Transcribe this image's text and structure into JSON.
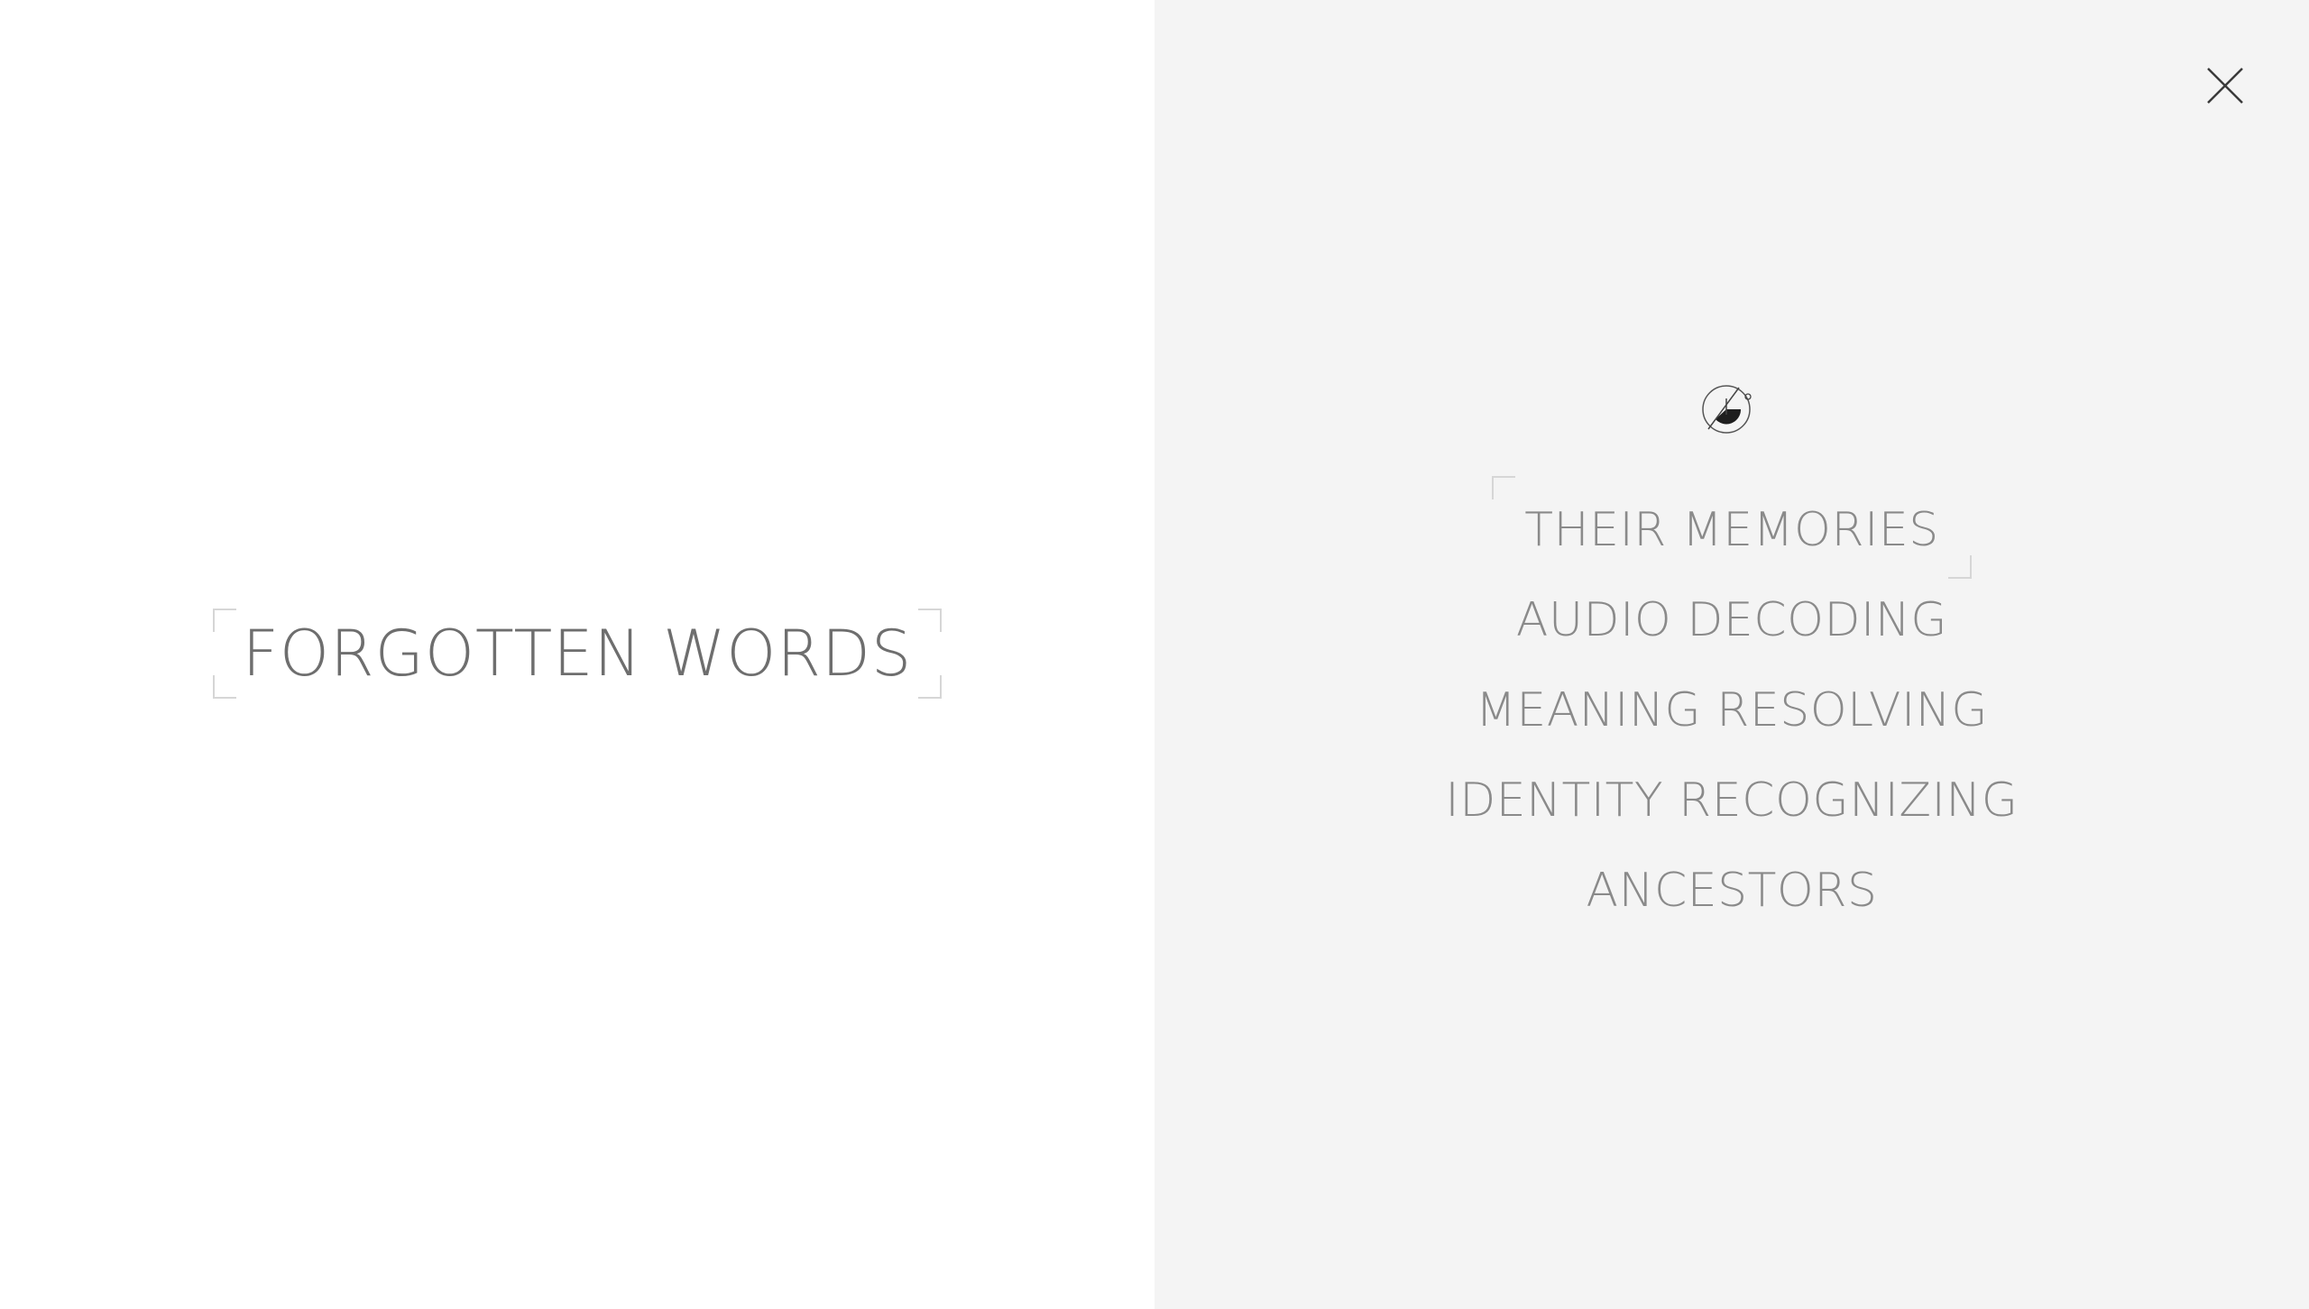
{
  "hero": {
    "title": "FORGOTTEN WORDS"
  },
  "header": {
    "close_icon": "close-icon",
    "logo_icon": "brand-logo-icon"
  },
  "menu": {
    "items": [
      {
        "label": "THEIR MEMORIES",
        "active": true
      },
      {
        "label": "AUDIO DECODING",
        "active": false
      },
      {
        "label": "MEANING RESOLVING",
        "active": false
      },
      {
        "label": "IDENTITY RECOGNIZING",
        "active": false
      },
      {
        "label": "ANCESTORS",
        "active": false
      }
    ]
  },
  "colors": {
    "left_background": "#ffffff",
    "right_background": "#f4f4f4",
    "text": "#8a8a8a",
    "bracket": "#d6d6d6"
  }
}
